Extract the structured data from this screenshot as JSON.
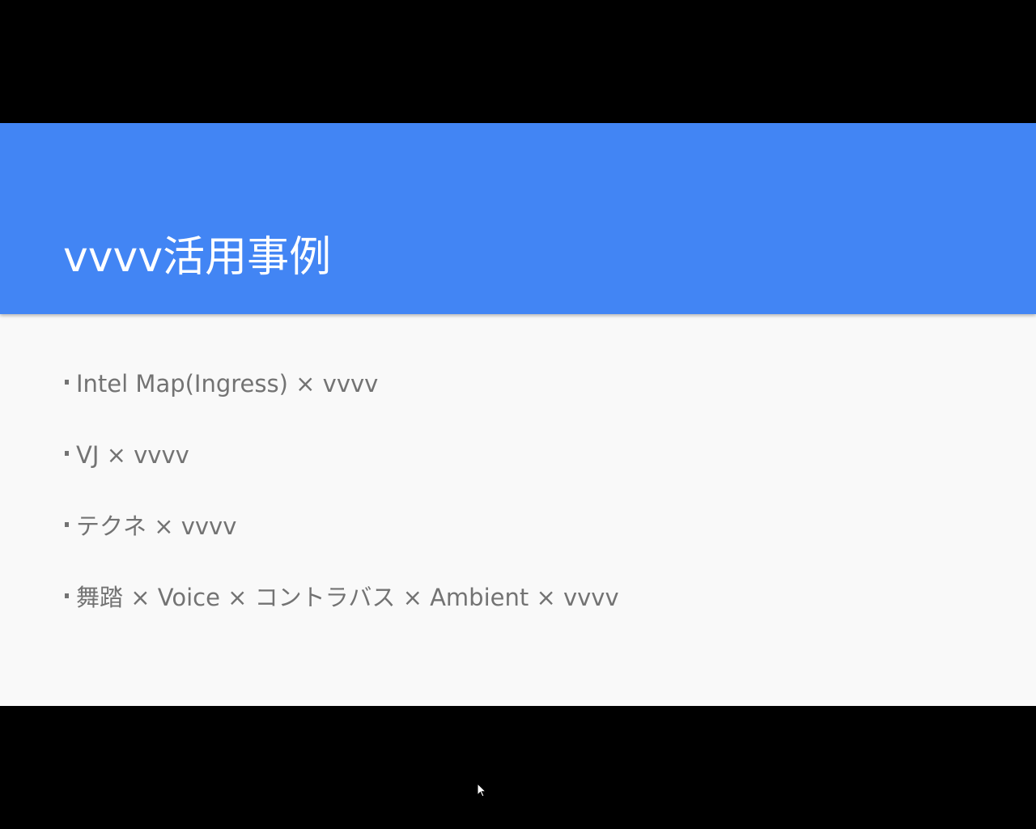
{
  "slide": {
    "title": "vvvv活用事例",
    "header_color": "#4285f4",
    "background_color": "#f9f9f9",
    "text_color": "#737373",
    "bullets": [
      {
        "text": "Intel Map(Ingress) × vvvv"
      },
      {
        "text": "VJ × vvvv"
      },
      {
        "text": "テクネ × vvvv"
      },
      {
        "text": "舞踏 × Voice × コントラバス × Ambient × vvvv"
      }
    ]
  },
  "cursor": {
    "icon": "mouse-pointer-icon"
  }
}
